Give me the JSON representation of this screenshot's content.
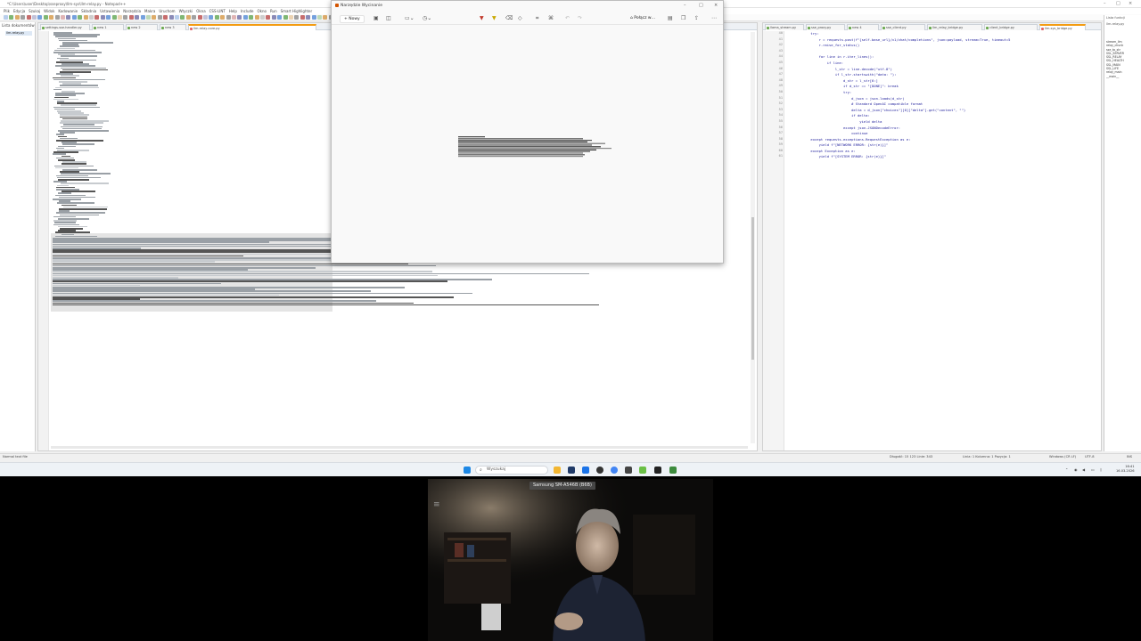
{
  "npp": {
    "title": "*C:\\Users\\user\\Desktop\\sseproxy\\llm-sys\\llm-relay.py - Notepad++",
    "menu": [
      "Plik",
      "Edycja",
      "Szukaj",
      "Widok",
      "Kodowanie",
      "Składnia",
      "Ustawienia",
      "Narzędzia",
      "Makra",
      "Uruchom",
      "Wtyczki",
      "Okna",
      "CSS-LINT",
      "Help",
      "Include",
      "Okno",
      "Run",
      "Smart Highlighter"
    ],
    "left_panel_title": "Lista dokumentów",
    "left_panel_selected": "llm-relay.py",
    "view1_tabs": [
      "settings-sse-handler.py",
      "new 1",
      "new 2",
      "new 3",
      "llm-relay-core.py"
    ],
    "view2_tabs": [
      "llama_stream.py",
      "sse_proxy.py",
      "new 4",
      "sse_client.py",
      "llm_relay_bridge.py",
      "client_bridge.py",
      "llm-sys_bridge.py"
    ],
    "func_panel_title": "Lista funkcji",
    "func_panel_sub": "llm-relay.py",
    "func_items": [
      "stream_llm",
      "relay_chunk",
      "sse_to_str",
      "SSL_SERVER",
      "SSL_RELAY",
      "SSL_HEALTH",
      "SSL_MAIN",
      "SSL_LIFE",
      "relay_main",
      "__main__"
    ],
    "status": {
      "left": "Normal text file",
      "pos": "Długość: 15 123   Linie: 343",
      "ln": "Linia: 1   Kolumna: 1   Pozycja: 1",
      "eol": "Windows (CR LF)",
      "enc": "UTF-8",
      "ins": "INS"
    },
    "code_start_line": 40,
    "code_lines": [
      "            try:",
      "                r = requests.post(f\"{self.base_url}/v1/chat/completions\", json=payload, stream=True, timeout=5",
      "                r.raise_for_status()",
      "",
      "                for line in r.iter_lines():",
      "                    if line:",
      "                        l_str = line.decode(\"utf-8\")",
      "                        if l_str.startswith(\"data: \"):",
      "                            d_str = l_str[6:]",
      "                            if d_str == \"[DONE]\": break",
      "                            try:",
      "                                d_json = json.loads(d_str)",
      "                                # Standard OpenAI compatible format",
      "                                delta = d_json[\"choices\"][0][\"delta\"].get(\"content\", \"\")",
      "                                if delta:",
      "                                    yield delta",
      "                            except json.JSONDecodeError:",
      "                                continue",
      "            except requests.exceptions.RequestException as e:",
      "                yield f\"[NETWORK ERROR: {str(e)}]\"",
      "            except Exception as e:",
      "                yield f\"[SYSTEM ERROR: {str(e)}]\""
    ]
  },
  "snip": {
    "title": "Narzędzie Wycinanie",
    "new_label": "Nowy",
    "share_label": "Połącz w…"
  },
  "taskbar": {
    "search_placeholder": "Wyszukaj",
    "time": "16:41",
    "date": "16.03.2026"
  },
  "phone": {
    "label": "Samsung SM-A546B (B6B)"
  }
}
